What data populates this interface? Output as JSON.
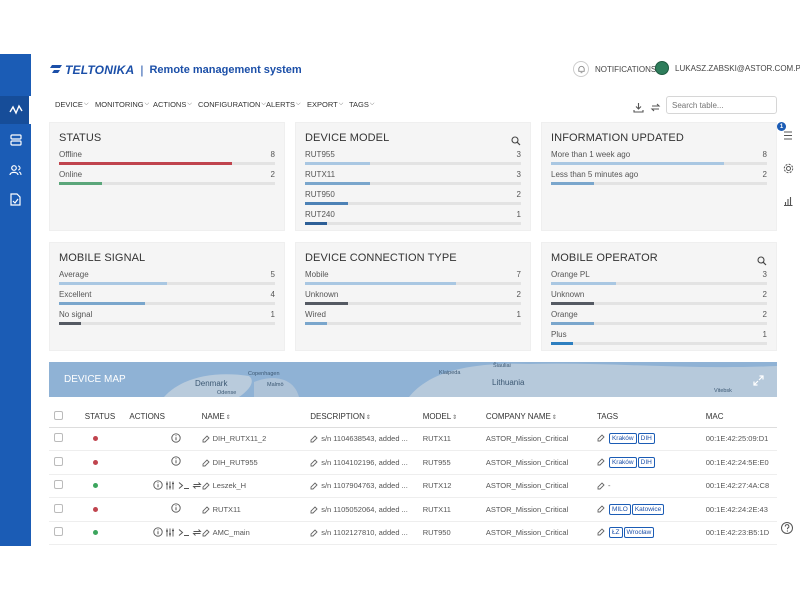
{
  "header": {
    "brand": "TELTONIKA",
    "separator": "|",
    "title": "Remote management system",
    "notifications": "NOTIFICATIONS",
    "user": "LUKASZ.ZABSKI@ASTOR.COM.PL"
  },
  "toolbar": {
    "menus": [
      "DEVICE",
      "MONITORING",
      "ACTIONS",
      "CONFIGURATION",
      "ALERTS",
      "EXPORT",
      "TAGS"
    ],
    "search_placeholder": "Search table..."
  },
  "right_rail": {
    "badge": "1"
  },
  "cards": {
    "status": {
      "title": "STATUS",
      "rows": [
        {
          "label": "Offline",
          "value": "8",
          "fraction": 0.8,
          "color": "#c0444e"
        },
        {
          "label": "Online",
          "value": "2",
          "fraction": 0.2,
          "color": "#5ba67a"
        }
      ]
    },
    "model": {
      "title": "DEVICE MODEL",
      "rows": [
        {
          "label": "RUT955",
          "value": "3",
          "fraction": 0.3,
          "color": "#a9c7e2"
        },
        {
          "label": "RUTX11",
          "value": "3",
          "fraction": 0.3,
          "color": "#7aa6cc"
        },
        {
          "label": "RUT950",
          "value": "2",
          "fraction": 0.2,
          "color": "#4d82b6"
        },
        {
          "label": "RUT240",
          "value": "1",
          "fraction": 0.1,
          "color": "#2d5f97"
        }
      ]
    },
    "info": {
      "title": "INFORMATION UPDATED",
      "rows": [
        {
          "label": "More than 1 week ago",
          "value": "8",
          "fraction": 0.8,
          "color": "#a9c7e2"
        },
        {
          "label": "Less than 5 minutes ago",
          "value": "2",
          "fraction": 0.2,
          "color": "#7aa6cc"
        }
      ]
    },
    "signal": {
      "title": "MOBILE SIGNAL",
      "rows": [
        {
          "label": "Average",
          "value": "5",
          "fraction": 0.5,
          "color": "#a9c7e2"
        },
        {
          "label": "Excellent",
          "value": "4",
          "fraction": 0.4,
          "color": "#7aa6cc"
        },
        {
          "label": "No signal",
          "value": "1",
          "fraction": 0.1,
          "color": "#555a63"
        }
      ]
    },
    "conn": {
      "title": "DEVICE CONNECTION TYPE",
      "rows": [
        {
          "label": "Mobile",
          "value": "7",
          "fraction": 0.7,
          "color": "#a9c7e2"
        },
        {
          "label": "Unknown",
          "value": "2",
          "fraction": 0.2,
          "color": "#555a63"
        },
        {
          "label": "Wired",
          "value": "1",
          "fraction": 0.1,
          "color": "#7aa6cc"
        }
      ]
    },
    "operator": {
      "title": "MOBILE OPERATOR",
      "rows": [
        {
          "label": "Orange PL",
          "value": "3",
          "fraction": 0.3,
          "color": "#a9c7e2"
        },
        {
          "label": "Unknown",
          "value": "2",
          "fraction": 0.2,
          "color": "#555a63"
        },
        {
          "label": "Orange",
          "value": "2",
          "fraction": 0.2,
          "color": "#7aa6cc"
        },
        {
          "label": "Plus",
          "value": "1",
          "fraction": 0.1,
          "color": "#2d7fc0"
        }
      ]
    }
  },
  "map": {
    "title": "DEVICE MAP",
    "labels": [
      "Denmark",
      "Copenhagen",
      "Malmö",
      "Klaipeda",
      "Lithuania",
      "Šiauliai",
      "Vitebsk",
      "Odense"
    ]
  },
  "table": {
    "headers": [
      "STATUS",
      "ACTIONS",
      "NAME",
      "DESCRIPTION",
      "MODEL",
      "COMPANY NAME",
      "TAGS",
      "MAC"
    ],
    "rows": [
      {
        "status_color": "#c0444e",
        "name": "DIH_RUTX11_2",
        "description": "s/n 1104638543, added ...",
        "model": "RUTX11",
        "company": "ASTOR_Mission_Critical",
        "tags": [
          "Kraków",
          "DIH"
        ],
        "mac": "00:1E:42:25:09:D1"
      },
      {
        "status_color": "#c0444e",
        "name": "DIH_RUT955",
        "description": "s/n 1104102196, added ...",
        "model": "RUT955",
        "company": "ASTOR_Mission_Critical",
        "tags": [
          "Kraków",
          "DIH"
        ],
        "mac": "00:1E:42:24:5E:E0"
      },
      {
        "status_color": "#3ba55d",
        "name": "Leszek_H",
        "description": "s/n 1107904763, added ...",
        "model": "RUTX12",
        "company": "ASTOR_Mission_Critical",
        "tags": [],
        "notag": "-",
        "mac": "00:1E:42:27:4A:C8"
      },
      {
        "status_color": "#c0444e",
        "name": "RUTX11",
        "description": "s/n 1105052064, added ...",
        "model": "RUTX11",
        "company": "ASTOR_Mission_Critical",
        "tags": [
          "MILO",
          "Katowice"
        ],
        "mac": "00:1E:42:24:2E:43"
      },
      {
        "status_color": "#3ba55d",
        "name": "AMC_main",
        "description": "s/n 1102127810, added ...",
        "model": "RUT950",
        "company": "ASTOR_Mission_Critical",
        "tags": [
          "ŁZ",
          "Wrocław"
        ],
        "mac": "00:1E:42:23:B5:1D"
      }
    ]
  }
}
